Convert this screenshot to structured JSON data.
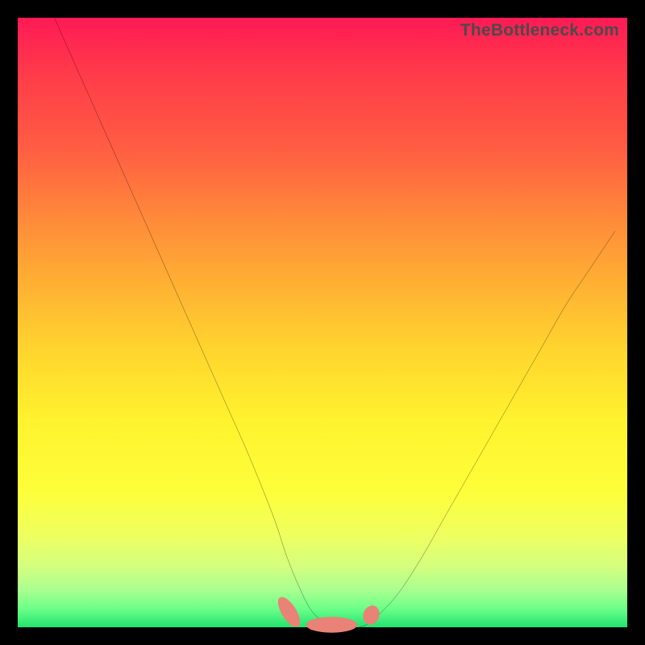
{
  "watermark": {
    "text": "TheBottleneck.com"
  },
  "chart_data": {
    "type": "line",
    "title": "",
    "xlabel": "",
    "ylabel": "",
    "xlim": [
      0,
      100
    ],
    "ylim": [
      0,
      100
    ],
    "legend": false,
    "grid": false,
    "series": [
      {
        "name": "bottleneck-curve",
        "color": "#000000",
        "x": [
          6,
          10,
          14,
          18,
          22,
          26,
          30,
          34,
          38,
          42,
          44,
          46,
          48,
          50,
          52,
          54,
          56,
          58,
          62,
          66,
          70,
          74,
          78,
          82,
          86,
          90,
          94,
          98
        ],
        "y": [
          100,
          91,
          82,
          73,
          64,
          55,
          46,
          37,
          28,
          18,
          12,
          7,
          3,
          1,
          0,
          0,
          0,
          1,
          5,
          11,
          18,
          25,
          32,
          39,
          46,
          53,
          59,
          65
        ]
      }
    ],
    "markers": [
      {
        "name": "left-bar-marker",
        "x": 44.5,
        "y": 2.5,
        "rx": 1.2,
        "ry": 2.8,
        "angle": -32,
        "color": "#e98277"
      },
      {
        "name": "center-bar-marker",
        "x": 51.5,
        "y": 0.4,
        "rx": 4.2,
        "ry": 1.3,
        "angle": 0,
        "color": "#e98277"
      },
      {
        "name": "right-dot-marker",
        "x": 58.0,
        "y": 2.0,
        "rx": 1.3,
        "ry": 1.6,
        "angle": 20,
        "color": "#e98277"
      }
    ],
    "gradient_stops": [
      {
        "pos": 0.0,
        "color": "#ff1a55"
      },
      {
        "pos": 0.5,
        "color": "#ffd62e"
      },
      {
        "pos": 0.8,
        "color": "#fdff3a"
      },
      {
        "pos": 1.0,
        "color": "#21e36e"
      }
    ]
  }
}
